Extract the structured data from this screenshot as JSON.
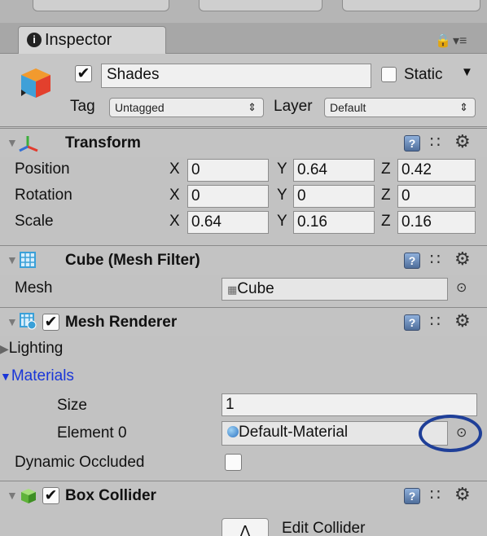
{
  "window": {
    "tab_title": "Inspector",
    "lock_icon": "lock-icon",
    "menu_icon": "tab-menu-icon"
  },
  "gameobject": {
    "active_checked": true,
    "name": "Shades",
    "static_label": "Static",
    "static_checked": false,
    "tag_label": "Tag",
    "tag_value": "Untagged",
    "layer_label": "Layer",
    "layer_value": "Default"
  },
  "transform": {
    "title": "Transform",
    "rows": [
      {
        "label": "Position",
        "x": "0",
        "y": "0.64",
        "z": "0.42"
      },
      {
        "label": "Rotation",
        "x": "0",
        "y": "0",
        "z": "0"
      },
      {
        "label": "Scale",
        "x": "0.64",
        "y": "0.16",
        "z": "0.16"
      }
    ],
    "axis_x": "X",
    "axis_y": "Y",
    "axis_z": "Z"
  },
  "mesh_filter": {
    "title": "Cube (Mesh Filter)",
    "mesh_label": "Mesh",
    "mesh_value": "Cube"
  },
  "mesh_renderer": {
    "title": "Mesh Renderer",
    "enabled": true,
    "lighting_label": "Lighting",
    "materials_label": "Materials",
    "size_label": "Size",
    "size_value": "1",
    "element0_label": "Element 0",
    "element0_value": "Default-Material",
    "dynamic_occluded_label": "Dynamic Occluded",
    "dynamic_occluded_checked": false
  },
  "box_collider": {
    "title": "Box Collider",
    "enabled": true,
    "edit_collider_label": "Edit Collider"
  },
  "colors": {
    "panel_bg": "#c2c2c2",
    "materials_blue": "#1a36d8",
    "annotation_circle": "#1f3f98"
  }
}
